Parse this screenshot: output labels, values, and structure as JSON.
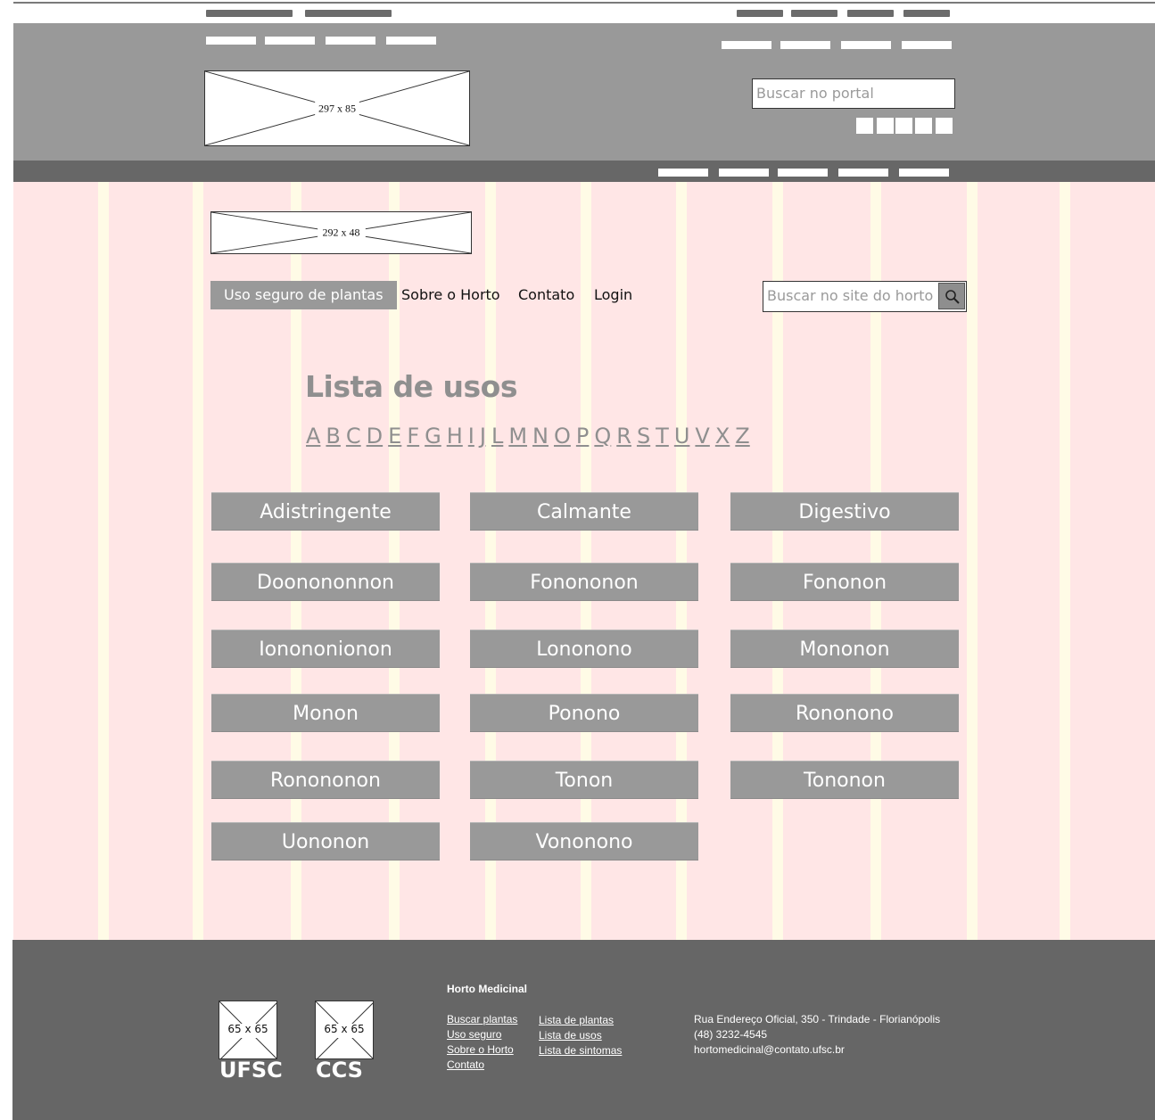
{
  "gov_header": {
    "logo_placeholder": "297 x 85",
    "portal_search_placeholder": "Buscar no portal"
  },
  "horto_header": {
    "logo_placeholder": "292 x 48",
    "nav": [
      {
        "label": "Uso seguro de plantas",
        "active": true
      },
      {
        "label": "Sobre o Horto",
        "active": false
      },
      {
        "label": "Contato",
        "active": false
      },
      {
        "label": "Login",
        "active": false
      }
    ],
    "search_placeholder": "Buscar no site do horto",
    "search_icon": "magnifier-icon"
  },
  "main": {
    "title": "Lista de usos",
    "alphabet": [
      "A",
      "B",
      "C",
      "D",
      "E",
      "F",
      "G",
      "H",
      "I",
      "J",
      "L",
      "M",
      "N",
      "O",
      "P",
      "Q",
      "R",
      "S",
      "T",
      "U",
      "V",
      "X",
      "Z"
    ],
    "uses": [
      "Adistringente",
      "Calmante",
      "Digestivo",
      "Doonononnon",
      "Fonononon",
      "Fononon",
      "Ionononionon",
      "Lononono",
      "Mononon",
      "Monon",
      "Ponono",
      "Rononono",
      "Ronononon",
      "Tonon",
      "Tononon",
      "Uononon",
      "Vononono"
    ]
  },
  "footer": {
    "logos": [
      {
        "placeholder": "65 x 65",
        "label": "UFSC"
      },
      {
        "placeholder": "65 x 65",
        "label": "CCS"
      }
    ],
    "title": "Horto Medicinal",
    "links_col1": [
      "Buscar plantas",
      "Uso seguro ",
      "Sobre o Horto",
      "Contato"
    ],
    "links_col2": [
      "Lista de plantas",
      "Lista de usos",
      "Lista de sintomas"
    ],
    "info": [
      "Rua Endereço Oficial, 350 - Trindade - Florianópolis",
      "(48) 3232-4545",
      "hortomedicinal@contato.ufsc.br"
    ]
  },
  "colors": {
    "header_gray": "#999999",
    "dark_gray": "#666666",
    "main_bg": "#ffe6e6",
    "guide_yellow": "#fffbe6",
    "text_gray": "#8f8f8f"
  }
}
